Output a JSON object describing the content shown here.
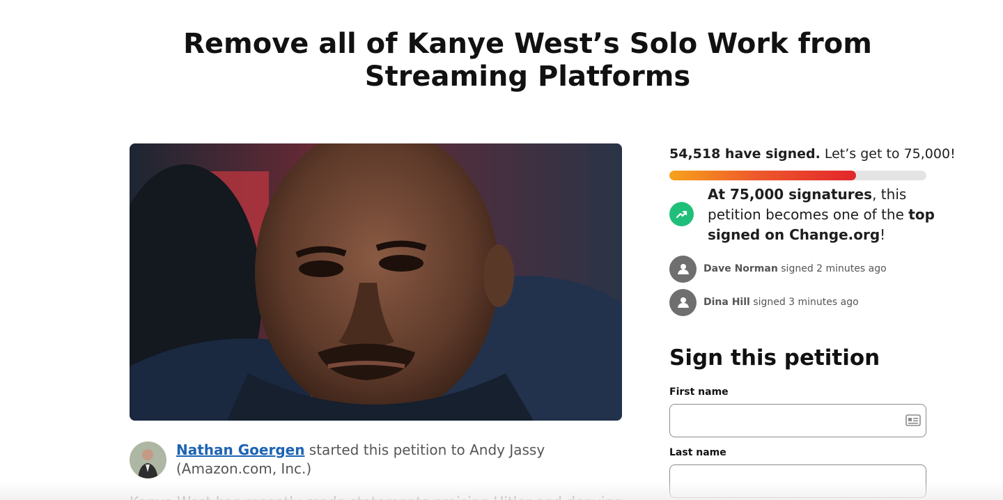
{
  "page": {
    "title": "Remove all of Kanye West’s Solo Work from Streaming Platforms"
  },
  "hero": {
    "icon": "photo-image"
  },
  "starter": {
    "name": "Nathan Goergen",
    "text": " started this petition to Andy Jassy (Amazon.com, Inc.)"
  },
  "body": {
    "first_line": "Kanye West has recently made statements praising Hitler and denying the"
  },
  "progress": {
    "signed_count": "54,518 have signed.",
    "goal_text": " Let’s get to 75,000!",
    "fraction": 0.727,
    "colors": {
      "start": "#f7a21b",
      "end": "#e2262b",
      "track": "#e4e4e4"
    }
  },
  "goal": {
    "prefix_bold": "At 75,000 signatures",
    "middle": ", this petition becomes one of the ",
    "bold_tail": "top signed on Change.org",
    "suffix": "!",
    "icon": "trending-up-icon",
    "icon_color": "#1fbf7a"
  },
  "recent_signers": [
    {
      "name": "Dave Norman",
      "action": " signed 2 minutes ago"
    },
    {
      "name": "Dina Hill",
      "action": " signed 3 minutes ago"
    }
  ],
  "form": {
    "heading": "Sign this petition",
    "first_name_label": "First name",
    "first_name_value": "",
    "last_name_label": "Last name",
    "last_name_value": ""
  }
}
